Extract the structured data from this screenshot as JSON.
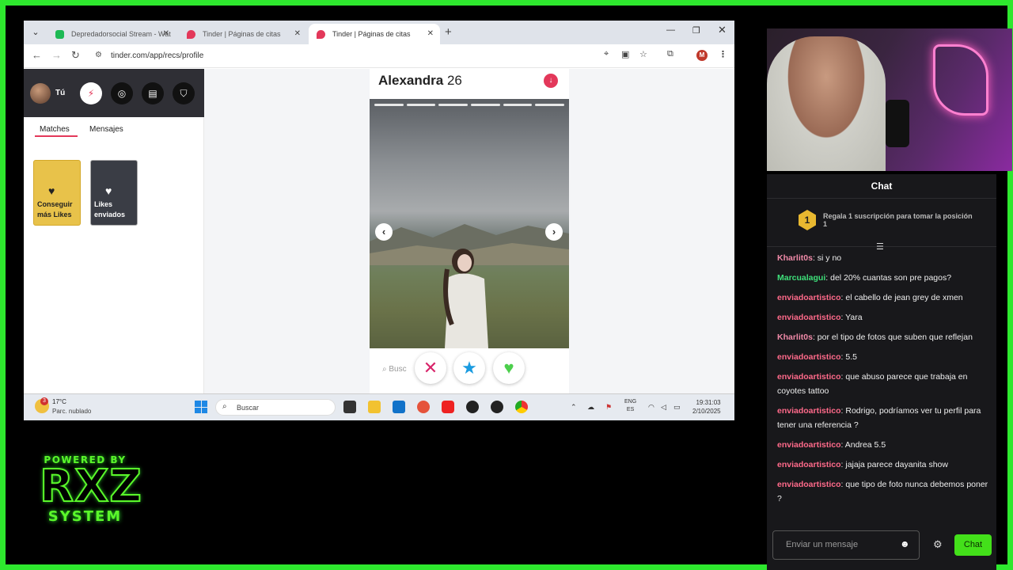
{
  "browser": {
    "tabs": [
      {
        "label": "Depredadorsocial Stream - Wat",
        "icon_color": "#1db954",
        "active": false
      },
      {
        "label": "Tinder | Páginas de citas",
        "icon_color": "#e3385a",
        "active": false
      },
      {
        "label": "Tinder | Páginas de citas",
        "icon_color": "#e3385a",
        "active": true
      }
    ],
    "url": "tinder.com/app/recs/profile",
    "profile_initial": "M"
  },
  "tinder": {
    "sidebar": {
      "you_label": "Tú",
      "tabs": [
        "Matches",
        "Mensajes"
      ],
      "cards": [
        {
          "label": "Conseguir más Likes"
        },
        {
          "label": "Likes enviados"
        }
      ]
    },
    "profile": {
      "name": "Alexandra",
      "age": "26",
      "search_placeholder": "Busc"
    }
  },
  "taskbar": {
    "weather_temp": "17°C",
    "weather_desc": "Parc. nublado",
    "weather_badge": "3",
    "search_placeholder": "Buscar",
    "lang_line1": "ENG",
    "lang_line2": "ES",
    "time": "19:31:03",
    "date": "2/10/2025"
  },
  "chat": {
    "title": "Chat",
    "promo_rank": "1",
    "promo_text": "Regala 1 suscripción para tomar la posición 1",
    "messages": [
      {
        "user": "Kharlit0s",
        "color": "#f08aa8",
        "text": ": si y no"
      },
      {
        "user": "Marcualagui",
        "color": "#3ee07a",
        "text": ": del 20% cuantas son pre pagos?"
      },
      {
        "user": "enviadoartistico",
        "color": "#ff6a8a",
        "text": ": el cabello de jean grey de xmen"
      },
      {
        "user": "enviadoartistico",
        "color": "#ff6a8a",
        "text": ": Yara"
      },
      {
        "user": "Kharlit0s",
        "color": "#f08aa8",
        "text": ": por el tipo de fotos que suben que reflejan"
      },
      {
        "user": "enviadoartistico",
        "color": "#ff6a8a",
        "text": ": 5.5"
      },
      {
        "user": "enviadoartistico",
        "color": "#ff6a8a",
        "text": ": que abuso parece que trabaja en coyotes tattoo"
      },
      {
        "user": "enviadoartistico",
        "color": "#ff6a8a",
        "text": ": Rodrigo, podríamos ver tu perfil para tener una referencia ?"
      },
      {
        "user": "enviadoartistico",
        "color": "#ff6a8a",
        "text": ": Andrea 5.5"
      },
      {
        "user": "enviadoartistico",
        "color": "#ff6a8a",
        "text": ": jajaja parece dayanita show"
      },
      {
        "user": "enviadoartistico",
        "color": "#ff6a8a",
        "text": ": que tipo de foto nunca debemos poner ?"
      }
    ],
    "input_placeholder": "Enviar un mensaje",
    "send_label": "Chat"
  },
  "overlay": {
    "powered_by": "POWERED BY",
    "brand": "RXZ",
    "brand_sub": "SYSTEM"
  }
}
